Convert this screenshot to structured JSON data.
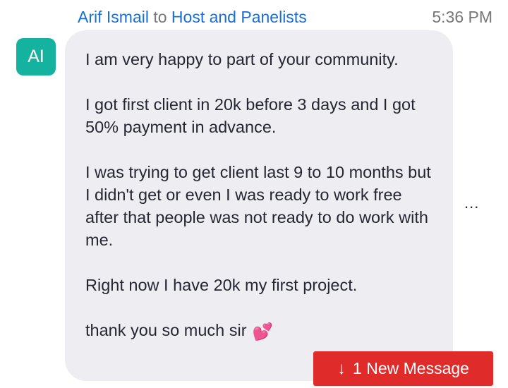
{
  "message": {
    "sender": "Arif Ismail",
    "to_word": "to",
    "recipient": "Host and Panelists",
    "time": "5:36 PM",
    "avatar_initials": "AI",
    "paragraphs": [
      "I am very happy to part of your community.",
      "I got first client in 20k before 3 days and I got 50% payment in advance.",
      "I was trying to get client last 9 to 10 months but I didn't get or even I was ready to work free after that people was not ready to do work with me.",
      "Right now I have 20k my first project.",
      "thank you so much sir"
    ],
    "emoji": "💕"
  },
  "more_options": "...",
  "new_message_banner": {
    "arrow": "↓",
    "label": "1 New Message"
  },
  "colors": {
    "link_blue": "#1a6ed8",
    "avatar_teal": "#15b2a0",
    "bubble_bg": "#eeeef2",
    "banner_red": "#e02b2b"
  }
}
